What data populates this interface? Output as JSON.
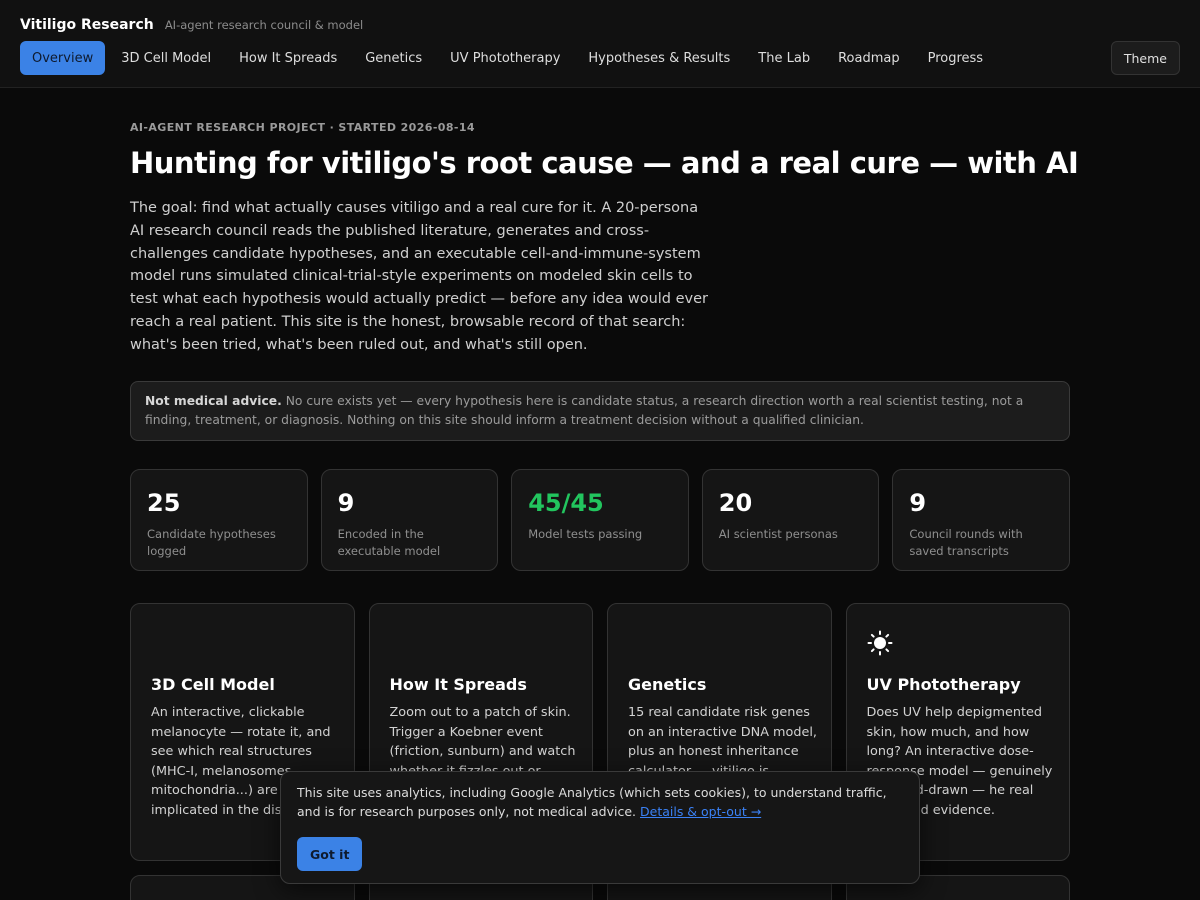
{
  "brand": {
    "name": "Vitiligo Research",
    "tagline": "AI-agent research council & model"
  },
  "nav": {
    "items": [
      {
        "label": "Overview",
        "active": true
      },
      {
        "label": "3D Cell Model"
      },
      {
        "label": "How It Spreads"
      },
      {
        "label": "Genetics"
      },
      {
        "label": "UV Phototherapy"
      },
      {
        "label": "Hypotheses & Results"
      },
      {
        "label": "The Lab"
      },
      {
        "label": "Roadmap"
      },
      {
        "label": "Progress"
      }
    ],
    "theme_label": "Theme"
  },
  "hero": {
    "eyebrow": "AI-AGENT RESEARCH PROJECT · STARTED 2026-08-14",
    "title": "Hunting for vitiligo's root cause — and a real cure — with AI",
    "intro": "The goal: find what actually causes vitiligo and a real cure for it. A 20-persona AI research council reads the published literature, generates and cross-challenges candidate hypotheses, and an executable cell-and-immune-system model runs simulated clinical-trial-style experiments on modeled skin cells to test what each hypothesis would actually predict — before any idea would ever reach a real patient. This site is the honest, browsable record of that search: what's been tried, what's been ruled out, and what's still open."
  },
  "disclaimer": {
    "bold": "Not medical advice.",
    "text": " No cure exists yet — every hypothesis here is candidate status, a research direction worth a real scientist testing, not a finding, treatment, or diagnosis. Nothing on this site should inform a treatment decision without a qualified clinician."
  },
  "stats": [
    {
      "value": "25",
      "label": "Candidate hypotheses logged"
    },
    {
      "value": "9",
      "label": "Encoded in the executable model"
    },
    {
      "value": "45/45",
      "label": "Model tests passing",
      "color": "#22c55e"
    },
    {
      "value": "20",
      "label": "AI scientist personas"
    },
    {
      "value": "9",
      "label": "Council rounds with saved transcripts"
    }
  ],
  "cards": [
    {
      "icon": "cell-icon",
      "title": "3D Cell Model",
      "desc": "An interactive, clickable melanocyte — rotate it, and see which real structures (MHC-I, melanosomes, mitochondria...) are a implicated in the dise why."
    },
    {
      "icon": "spread-icon",
      "title": "How It Spreads",
      "desc": "Zoom out to a patch of skin. Trigger a Koebner event (friction, sunburn) and watch whether it fizzles out or"
    },
    {
      "icon": "dna-icon",
      "title": "Genetics",
      "desc": "15 real candidate risk genes on an interactive DNA model, plus an honest inheritance calculator — vitiligo is"
    },
    {
      "icon": "sun-icon",
      "title": "UV Phototherapy",
      "desc": "Does UV help depigmented skin, how much, and how long? An interactive dose-response model — genuinely not hand-drawn — he real published evidence."
    }
  ],
  "cookie": {
    "text": "This site uses analytics, including Google Analytics (which sets cookies), to understand traffic, and is for research purposes only, not medical advice. ",
    "link": "Details & opt-out →",
    "button": "Got it"
  },
  "colors": {
    "accent": "#3b82e6",
    "success": "#22c55e",
    "background": "#0a0a0a",
    "card": "#151515"
  }
}
